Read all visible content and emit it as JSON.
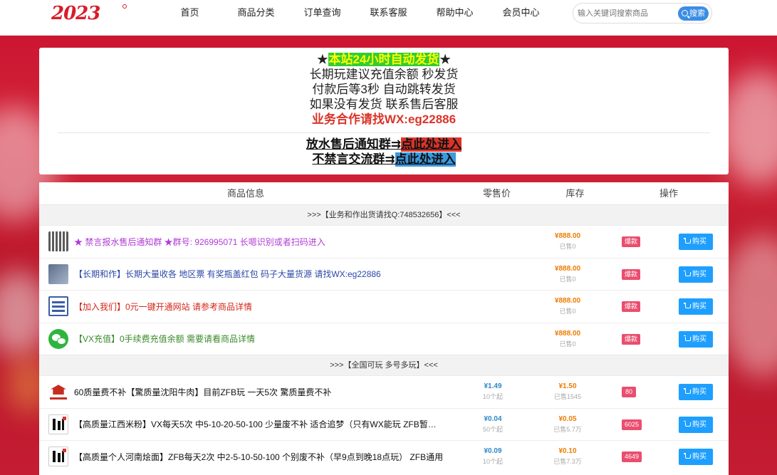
{
  "header": {
    "logo_text": "2023",
    "nav": [
      "首页",
      "商品分类",
      "订单查询",
      "联系客服",
      "帮助中心",
      "会员中心"
    ],
    "search": {
      "placeholder": "输入关键词搜索商品",
      "button": "搜索"
    }
  },
  "notice": {
    "line1_prefix": "★",
    "line1_highlight": "本站24小时自动发货",
    "line1_suffix": "★",
    "line2": "长期玩建议充值余额 秒发货",
    "line3": "付款后等3秒  自动跳转发货",
    "line4": "如果没有发货 联系售后客服",
    "line5": "业务合作请找WX:eg22886",
    "group1_text": "放水售后通知群⇉",
    "group1_link": "点此处进入",
    "group2_text": "不禁言交流群⇉",
    "group2_link": "点此处进入"
  },
  "table": {
    "headers": {
      "info": "商品信息",
      "price": "零售价",
      "stock": "库存",
      "op": "操作"
    },
    "section1": ">>>【业务和作出货请找Q:748532656】<<<",
    "section2": ">>>【全国可玩 多号多玩】<<<",
    "buy_label": "购买",
    "rows1": [
      {
        "icon": "qrcode-icon",
        "title": "★ 禁言报水售后通知群 ★群号: 926995071 长嗯识别或者扫码进入",
        "price": "¥888.00",
        "sold": "已售0",
        "stock": "爆款"
      },
      {
        "icon": "handshake-icon",
        "title": "【长期和作】长期大量收各 地区票 有奖瓶盖红包 码子大量货源 请找WX:eg22886",
        "price": "¥888.00",
        "sold": "已售0",
        "stock": "爆款"
      },
      {
        "icon": "join-us-icon",
        "title": "【加入我们】0元一键开通网站 请参考商品详情",
        "price": "¥888.00",
        "sold": "已售0",
        "stock": "爆款"
      },
      {
        "icon": "wechat-icon",
        "title": "【VX充值】0手续费充值余额 需要请看商品详情",
        "price": "¥888.00",
        "sold": "已售0",
        "stock": "爆款"
      }
    ],
    "rows2": [
      {
        "icon": "shop-logo-icon",
        "title": "60质量费不补【驚质量沈阳牛肉】目前ZFB玩 一天5次 驚质量费不补",
        "unit_price": "¥1.49",
        "unit_min": "10个起",
        "price": "¥1.50",
        "sold": "已售1545",
        "stock": "80"
      },
      {
        "icon": "jiangxi-logo-icon",
        "title": "【高质量江西米粉】VX每天5次 中5-10-20-50-100 少量废不补 适合追梦（只有WX能玩 ZFB暂不能玩）",
        "unit_price": "¥0.04",
        "unit_min": "50个起",
        "price": "¥0.05",
        "sold": "已售5.7万",
        "stock": "6025"
      },
      {
        "icon": "henan-logo-icon",
        "title": "【高质量个人河南烩面】ZFB每天2次 中2-5-10-50-100 个别废不补（早9点到晚18点玩） ZFB通用",
        "unit_price": "¥0.09",
        "unit_min": "10个起",
        "price": "¥0.10",
        "sold": "已售7.3万",
        "stock": "4649"
      }
    ]
  }
}
